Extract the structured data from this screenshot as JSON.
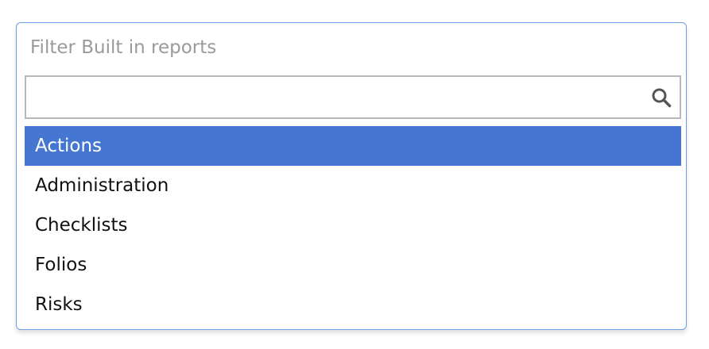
{
  "dropdown": {
    "header_label": "Filter Built in reports",
    "search": {
      "value": "",
      "placeholder": ""
    },
    "items": [
      {
        "label": "Actions",
        "selected": true
      },
      {
        "label": "Administration",
        "selected": false
      },
      {
        "label": "Checklists",
        "selected": false
      },
      {
        "label": "Folios",
        "selected": false
      },
      {
        "label": "Risks",
        "selected": false
      }
    ]
  },
  "colors": {
    "border": "#6f9de2",
    "selected_bg": "#4577d2",
    "selected_text": "#ffffff",
    "label_text": "#9a9a9a"
  },
  "icons": {
    "search": "search-icon"
  }
}
